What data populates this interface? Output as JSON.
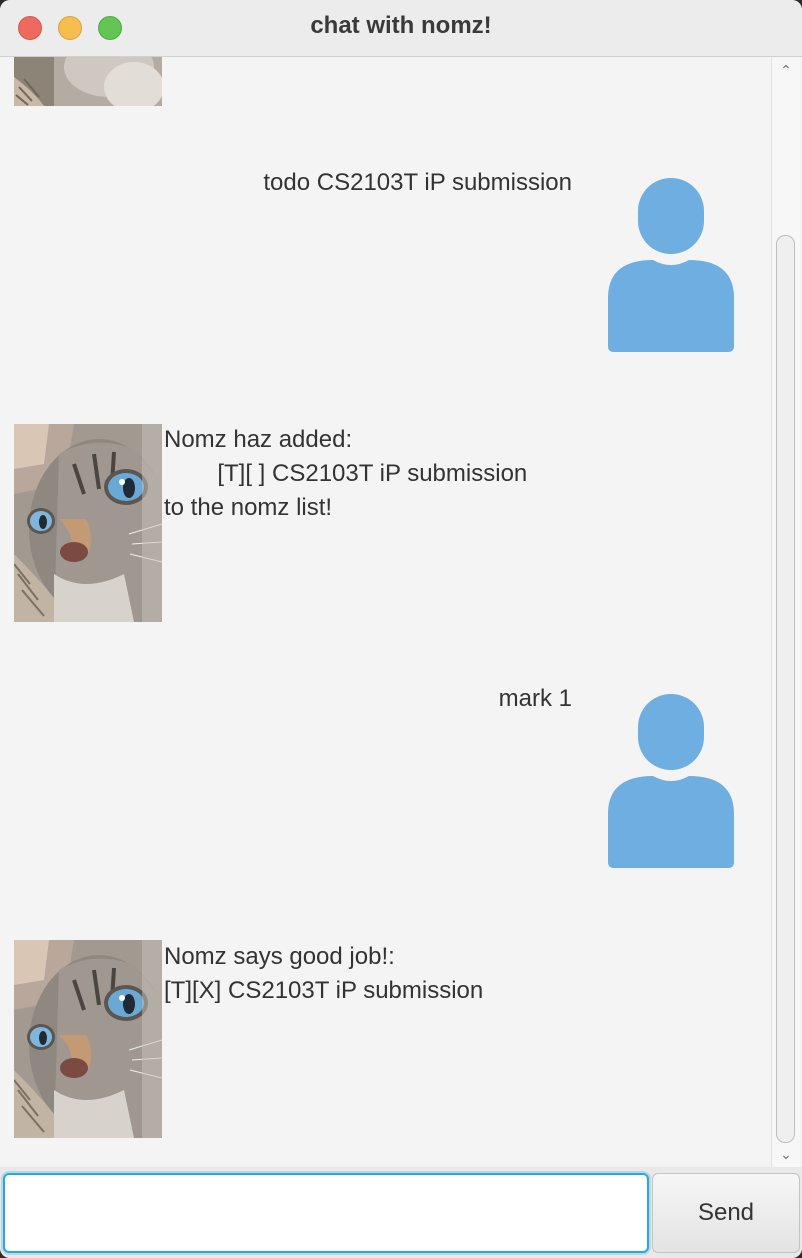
{
  "window": {
    "title": "chat with nomz!"
  },
  "messages": [
    {
      "sender": "user",
      "text": "todo CS2103T iP submission"
    },
    {
      "sender": "bot",
      "lines": [
        "Nomz haz added:",
        "        [T][ ] CS2103T iP submission",
        "to the nomz list!"
      ]
    },
    {
      "sender": "user",
      "text": "mark 1"
    },
    {
      "sender": "bot",
      "lines": [
        "Nomz says good job!:",
        "[T][X] CS2103T iP submission"
      ]
    }
  ],
  "input": {
    "value": "",
    "placeholder": ""
  },
  "send_button": {
    "label": "Send"
  },
  "colors": {
    "user_avatar": "#6eaee0",
    "input_focus": "#2aa8d8",
    "close": "#ee6a5f",
    "minimize": "#f5be4f",
    "maximize": "#62c554"
  },
  "icons": {
    "bot_avatar": "cat-photo",
    "user_avatar": "person-silhouette-icon",
    "scroll_up": "chevron-up-icon",
    "scroll_down": "chevron-down-icon"
  }
}
